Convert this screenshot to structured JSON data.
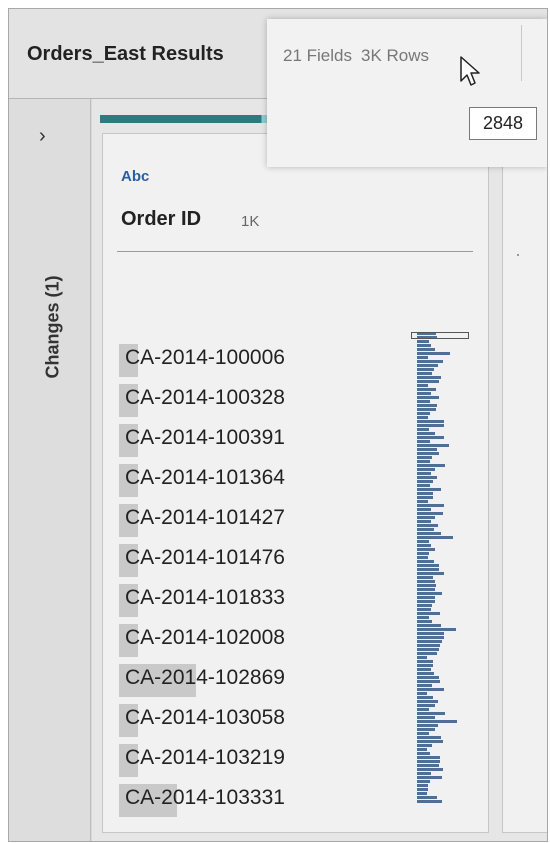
{
  "header": {
    "title": "Orders_East Results",
    "fields": "21 Fields",
    "rows": "3K Rows"
  },
  "tooltip": "2848",
  "sidebar": {
    "expand_icon": "chevron-right-icon",
    "changes_label": "Changes (1)"
  },
  "profile": {
    "field": {
      "type_label": "Abc",
      "name": "Order ID",
      "count": "1K"
    },
    "values": [
      {
        "label": "CA-2014-100006",
        "fraction": 0.16
      },
      {
        "label": "CA-2014-100328",
        "fraction": 0.16
      },
      {
        "label": "CA-2014-100391",
        "fraction": 0.16
      },
      {
        "label": "CA-2014-101364",
        "fraction": 0.16
      },
      {
        "label": "CA-2014-101427",
        "fraction": 0.16
      },
      {
        "label": "CA-2014-101476",
        "fraction": 0.16
      },
      {
        "label": "CA-2014-101833",
        "fraction": 0.16
      },
      {
        "label": "CA-2014-102008",
        "fraction": 0.16
      },
      {
        "label": "CA-2014-102869",
        "fraction": 0.66
      },
      {
        "label": "CA-2014-103058",
        "fraction": 0.16
      },
      {
        "label": "CA-2014-103219",
        "fraction": 0.16
      },
      {
        "label": "CA-2014-103331",
        "fraction": 0.5
      }
    ],
    "histogram_color": "#4f6f96",
    "value_bar_color": "#c9c9c9"
  },
  "colors": {
    "accent_dark": "#2f7a7e",
    "accent_light": "#8ccdd0",
    "type_label": "#2a5f9e"
  }
}
